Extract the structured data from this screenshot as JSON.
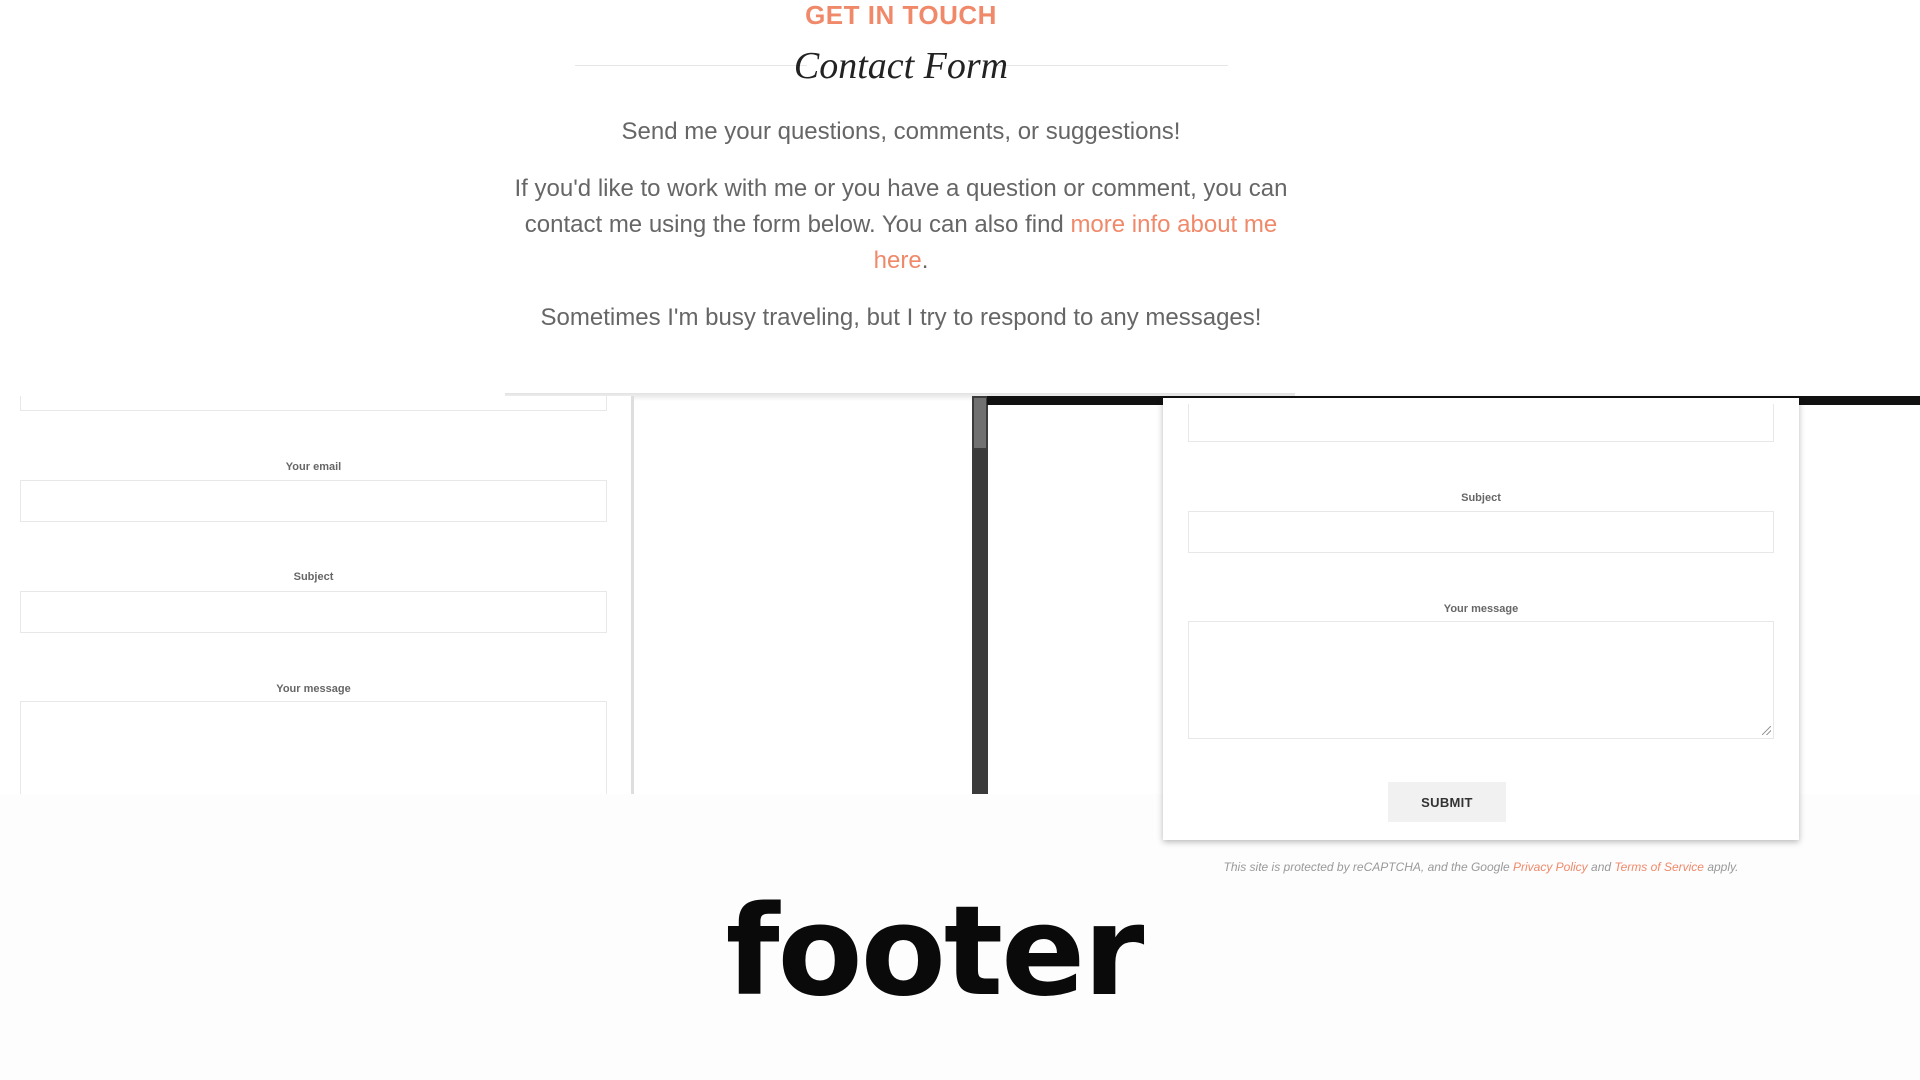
{
  "intro": {
    "eyebrow": "GET IN TOUCH",
    "title": "Contact Form",
    "lead": "Send me your questions, comments, or suggestions!",
    "para_before_link": "If you'd like to work with me or you have a question or comment, you can contact me using the form below. You can also find ",
    "link_text": "more info about me here",
    "para_after_link": ".",
    "note": "Sometimes I'm busy traveling, but I try to respond to any messages!"
  },
  "left_form": {
    "email_label": "Your email",
    "subject_label": "Subject",
    "message_label": "Your message"
  },
  "right_form": {
    "subject_label": "Subject",
    "message_label": "Your message",
    "submit_label": "SUBMIT"
  },
  "recaptcha": {
    "prefix": "This site is protected by reCAPTCHA, and the Google ",
    "privacy_link": "Privacy Policy",
    "and": " and ",
    "terms_link": "Terms of Service",
    "suffix": " apply."
  },
  "footer": {
    "label": "footer"
  },
  "colors": {
    "accent": "#f0896a",
    "heading": "#222222",
    "body_text": "#666666"
  }
}
